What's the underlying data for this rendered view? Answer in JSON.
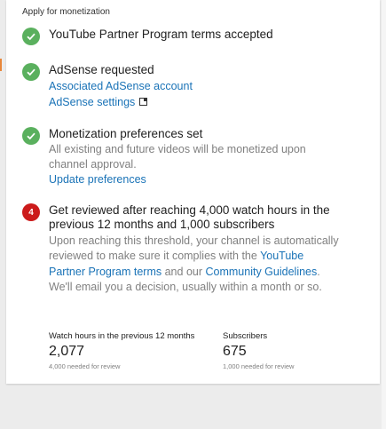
{
  "header": {
    "title": "Apply for monetization"
  },
  "steps": [
    {
      "status": "done",
      "title": "YouTube Partner Program terms accepted"
    },
    {
      "status": "done",
      "title": "AdSense requested",
      "links": [
        "Associated AdSense account",
        "AdSense settings"
      ]
    },
    {
      "status": "done",
      "title": "Monetization preferences set",
      "desc": "All existing and future videos will be monetized upon channel approval.",
      "link": "Update preferences"
    },
    {
      "status": "pending",
      "number": "4",
      "title": "Get reviewed after reaching 4,000 watch hours in the previous 12 months and 1,000 subscribers",
      "desc_part1": "Upon reaching this threshold, your channel is automatically reviewed to make sure it complies with the",
      "link1": "YouTube Partner Program terms",
      "desc_part2": "and our",
      "link2": "Community Guidelines",
      "desc_part3": ". We'll email you a decision, usually within a month or so."
    }
  ],
  "stats": {
    "watch_hours": {
      "label": "Watch hours in the previous 12 months",
      "value": "2,077",
      "sub": "4,000 needed for review"
    },
    "subscribers": {
      "label": "Subscribers",
      "value": "675",
      "sub": "1,000 needed for review"
    }
  },
  "colors": {
    "done": "#5ab05e",
    "pending": "#cc1b1b",
    "link": "#1a73b7"
  }
}
